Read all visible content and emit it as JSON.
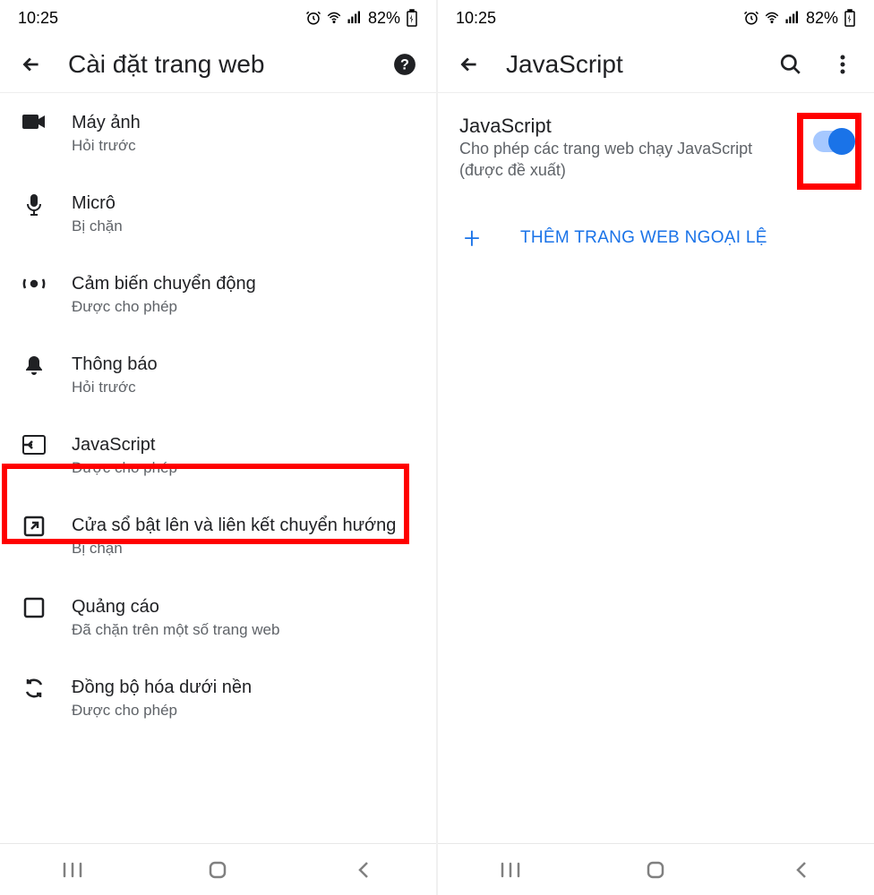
{
  "status": {
    "time": "10:25",
    "battery": "82%"
  },
  "left": {
    "title": "Cài đặt trang web",
    "items": [
      {
        "icon": "camera",
        "title": "Máy ảnh",
        "sub": "Hỏi trước"
      },
      {
        "icon": "mic",
        "title": "Micrô",
        "sub": "Bị chặn"
      },
      {
        "icon": "motion",
        "title": "Cảm biến chuyển động",
        "sub": "Được cho phép"
      },
      {
        "icon": "bell",
        "title": "Thông báo",
        "sub": "Hỏi trước"
      },
      {
        "icon": "js",
        "title": "JavaScript",
        "sub": "Được cho phép"
      },
      {
        "icon": "popup",
        "title": "Cửa sổ bật lên và liên kết chuyển hướng",
        "sub": "Bị chặn"
      },
      {
        "icon": "ads",
        "title": "Quảng cáo",
        "sub": "Đã chặn trên một số trang web"
      },
      {
        "icon": "sync",
        "title": "Đồng bộ hóa dưới nền",
        "sub": "Được cho phép"
      }
    ]
  },
  "right": {
    "title": "JavaScript",
    "toggle_title": "JavaScript",
    "toggle_desc": "Cho phép các trang web chạy JavaScript (được đề xuất)",
    "toggle_on": true,
    "add_label": "THÊM TRANG WEB NGOẠI LỆ"
  }
}
